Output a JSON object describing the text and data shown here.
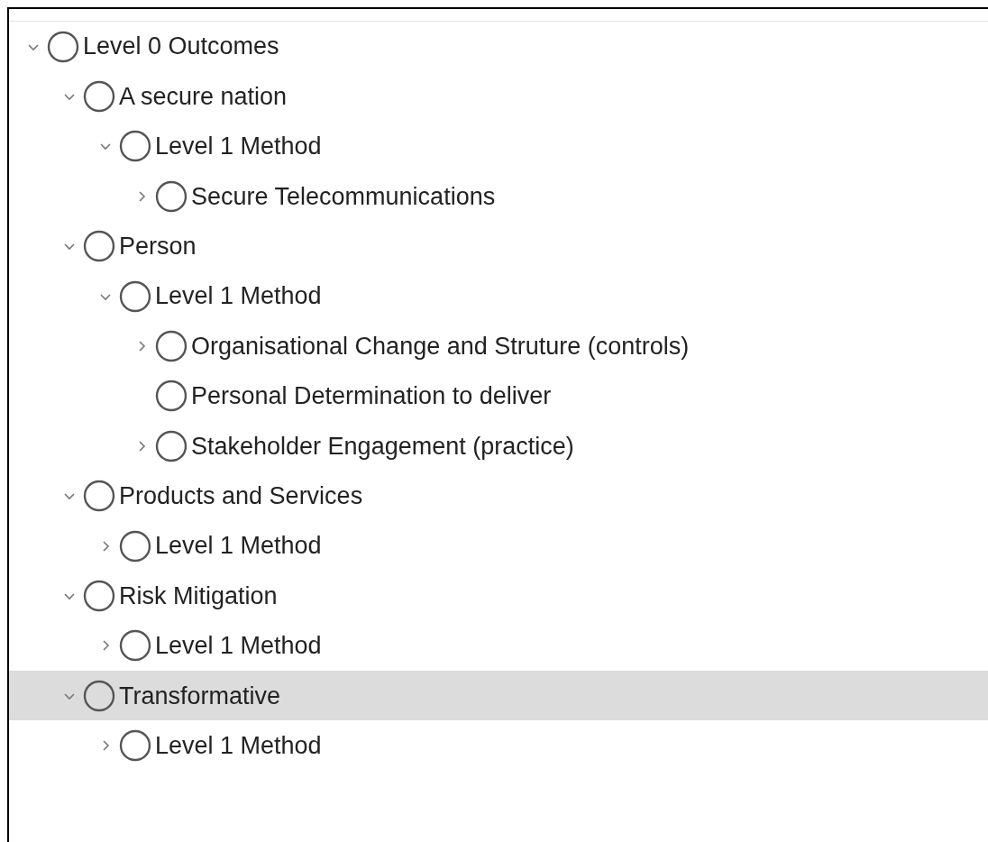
{
  "outline": [
    {
      "label": "Level 0 Outcomes",
      "expanded": true,
      "selected": false,
      "children": [
        {
          "label": "A secure nation",
          "expanded": true,
          "selected": false,
          "children": [
            {
              "label": "Level 1 Method",
              "expanded": true,
              "selected": false,
              "children": [
                {
                  "label": "Secure Telecommunications",
                  "expanded": false,
                  "selected": false
                }
              ]
            }
          ]
        },
        {
          "label": "Person",
          "expanded": true,
          "selected": false,
          "children": [
            {
              "label": "Level 1 Method",
              "expanded": true,
              "selected": false,
              "children": [
                {
                  "label": "Organisational Change and Struture (controls)",
                  "expanded": false,
                  "selected": false
                },
                {
                  "label": "Personal Determination to deliver",
                  "selected": false
                },
                {
                  "label": "Stakeholder Engagement (practice)",
                  "expanded": false,
                  "selected": false
                }
              ]
            }
          ]
        },
        {
          "label": "Products and Services",
          "expanded": true,
          "selected": false,
          "children": [
            {
              "label": "Level 1 Method",
              "expanded": false,
              "selected": false
            }
          ]
        },
        {
          "label": "Risk Mitigation",
          "expanded": true,
          "selected": false,
          "children": [
            {
              "label": "Level 1 Method",
              "expanded": false,
              "selected": false
            }
          ]
        },
        {
          "label": "Transformative",
          "expanded": true,
          "selected": true,
          "children": [
            {
              "label": "Level 1 Method",
              "expanded": false,
              "selected": false
            }
          ]
        }
      ]
    }
  ]
}
